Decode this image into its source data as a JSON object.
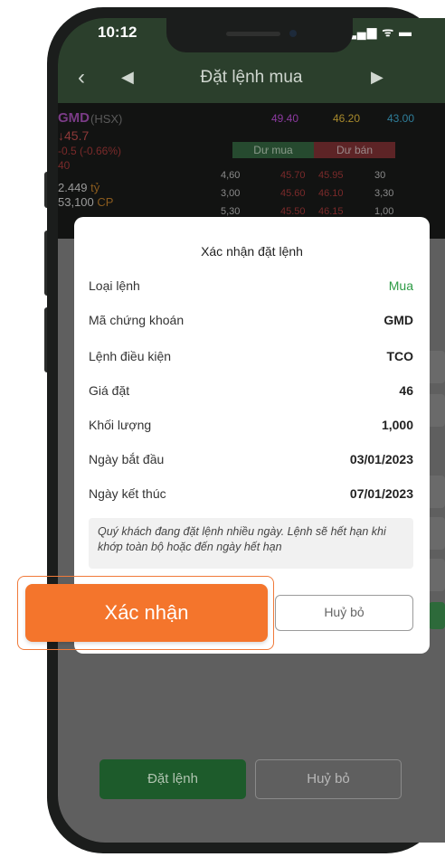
{
  "status": {
    "time": "10:12",
    "signal": "▂▄▆ ᯤ ▬"
  },
  "nav": {
    "back": "‹",
    "prev": "◀",
    "title": "Đặt lệnh mua",
    "next": "▶"
  },
  "quote": {
    "symbol": "GMD",
    "exchange": "(HSX)",
    "ceiling": "49.40",
    "reference": "46.20",
    "floor": "43.00",
    "price": "↓45.7",
    "change": "-0.5 (-0.66%)",
    "volume": "40",
    "value": "2.449",
    "value_unit": "tỷ",
    "shares": "53,100",
    "shares_unit": "CP",
    "buy_header": "Dư mua",
    "sell_header": "Dư bán",
    "orderbook": [
      {
        "bq": "4,60",
        "bp": "45.70",
        "sp": "45.95",
        "sq": "30"
      },
      {
        "bq": "3,00",
        "bp": "45.60",
        "sp": "46.10",
        "sq": "3,30"
      },
      {
        "bq": "5,30",
        "bp": "45.50",
        "sp": "46.15",
        "sq": "1,00"
      }
    ],
    "colors": {
      "ceiling": "#8c3aa0",
      "reference": "#a88a2c",
      "floor": "#2f7e9a"
    }
  },
  "modal": {
    "title": "Xác nhận đặt lệnh",
    "rows": [
      {
        "label": "Loại lệnh",
        "value": "Mua"
      },
      {
        "label": "Mã chứng khoán",
        "value": "GMD"
      },
      {
        "label": "Lệnh điều kiện",
        "value": "TCO"
      },
      {
        "label": "Giá đặt",
        "value": "46"
      },
      {
        "label": "Khối lượng",
        "value": "1,000"
      },
      {
        "label": "Ngày bắt đầu",
        "value": "03/01/2023"
      },
      {
        "label": "Ngày kết thúc",
        "value": "07/01/2023"
      }
    ],
    "note": "Quý khách đang đặt lệnh nhiều ngày. Lệnh sẽ hết hạn khi khớp toàn bộ hoặc đến ngày hết hạn",
    "confirm_label": "Xác nhận",
    "cancel_label": "Huỷ bỏ"
  },
  "bottom": {
    "confirm_label": "Đặt lệnh",
    "cancel_label": "Huỷ bỏ"
  },
  "accent": {
    "confirm": "#f4752c",
    "buy": "#2e9b46"
  }
}
